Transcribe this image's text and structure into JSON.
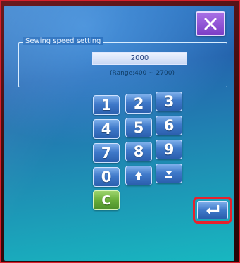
{
  "dialog": {
    "close_icon": "close-x-icon",
    "accent_color": "#8a4fd6"
  },
  "speed_setting": {
    "label": "Sewing speed setting",
    "value": "2000",
    "range": "(Range:400 ~ 2700)"
  },
  "keypad": {
    "keys": [
      "1",
      "2",
      "3",
      "4",
      "5",
      "6",
      "7",
      "8",
      "9",
      "0"
    ],
    "up_icon": "arrow-up-icon",
    "down_icon": "arrow-down-icon",
    "clear_label": "C"
  },
  "enter": {
    "icon": "enter-return-icon",
    "highlight_color": "#e8222d"
  }
}
